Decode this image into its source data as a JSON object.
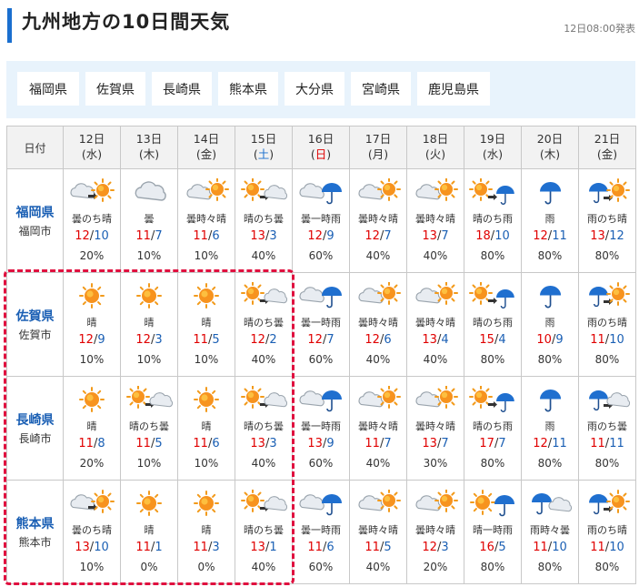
{
  "header": {
    "title": "九州地方の10日間天気",
    "issued": "12日08:00発表"
  },
  "prefectures": [
    "福岡県",
    "佐賀県",
    "長崎県",
    "熊本県",
    "大分県",
    "宮崎県",
    "鹿児島県"
  ],
  "table": {
    "corner_label": "日付",
    "days": [
      {
        "date": "12日",
        "dow": "(水)",
        "dow_type": "normal"
      },
      {
        "date": "13日",
        "dow": "(木)",
        "dow_type": "normal"
      },
      {
        "date": "14日",
        "dow": "(金)",
        "dow_type": "normal"
      },
      {
        "date": "15日",
        "dow": "(土)",
        "dow_type": "sat"
      },
      {
        "date": "16日",
        "dow": "(日)",
        "dow_type": "sun"
      },
      {
        "date": "17日",
        "dow": "(月)",
        "dow_type": "normal"
      },
      {
        "date": "18日",
        "dow": "(火)",
        "dow_type": "normal"
      },
      {
        "date": "19日",
        "dow": "(水)",
        "dow_type": "normal"
      },
      {
        "date": "20日",
        "dow": "(木)",
        "dow_type": "normal"
      },
      {
        "date": "21日",
        "dow": "(金)",
        "dow_type": "normal"
      }
    ],
    "rows": [
      {
        "pref": "福岡県",
        "city": "福岡市",
        "cells": [
          {
            "icon": "cloudy-then-sunny",
            "text": "曇のち晴",
            "hi": "12",
            "lo": "10",
            "pop": "20%"
          },
          {
            "icon": "cloudy",
            "text": "曇",
            "hi": "11",
            "lo": "7",
            "pop": "10%"
          },
          {
            "icon": "cloudy-sometimes-sunny",
            "text": "曇時々晴",
            "hi": "11",
            "lo": "6",
            "pop": "10%"
          },
          {
            "icon": "sunny-then-cloudy",
            "text": "晴のち曇",
            "hi": "13",
            "lo": "3",
            "pop": "40%"
          },
          {
            "icon": "cloudy-sometimes-rain",
            "text": "曇一時雨",
            "hi": "12",
            "lo": "9",
            "pop": "60%"
          },
          {
            "icon": "cloudy-sometimes-sunny",
            "text": "曇時々晴",
            "hi": "12",
            "lo": "7",
            "pop": "40%"
          },
          {
            "icon": "cloudy-sometimes-sunny",
            "text": "曇時々晴",
            "hi": "13",
            "lo": "7",
            "pop": "40%"
          },
          {
            "icon": "sunny-then-rain",
            "text": "晴のち雨",
            "hi": "18",
            "lo": "10",
            "pop": "80%"
          },
          {
            "icon": "rain",
            "text": "雨",
            "hi": "12",
            "lo": "11",
            "pop": "80%"
          },
          {
            "icon": "rain-then-sunny",
            "text": "雨のち晴",
            "hi": "13",
            "lo": "12",
            "pop": "80%"
          }
        ]
      },
      {
        "pref": "佐賀県",
        "city": "佐賀市",
        "cells": [
          {
            "icon": "sunny",
            "text": "晴",
            "hi": "12",
            "lo": "9",
            "pop": "10%"
          },
          {
            "icon": "sunny",
            "text": "晴",
            "hi": "12",
            "lo": "3",
            "pop": "10%"
          },
          {
            "icon": "sunny",
            "text": "晴",
            "hi": "11",
            "lo": "5",
            "pop": "10%"
          },
          {
            "icon": "sunny-then-cloudy",
            "text": "晴のち曇",
            "hi": "12",
            "lo": "2",
            "pop": "40%"
          },
          {
            "icon": "cloudy-sometimes-rain",
            "text": "曇一時雨",
            "hi": "12",
            "lo": "7",
            "pop": "60%"
          },
          {
            "icon": "cloudy-sometimes-sunny",
            "text": "曇時々晴",
            "hi": "12",
            "lo": "6",
            "pop": "40%"
          },
          {
            "icon": "cloudy-sometimes-sunny",
            "text": "曇時々晴",
            "hi": "13",
            "lo": "4",
            "pop": "40%"
          },
          {
            "icon": "sunny-then-rain",
            "text": "晴のち雨",
            "hi": "15",
            "lo": "4",
            "pop": "80%"
          },
          {
            "icon": "rain",
            "text": "雨",
            "hi": "10",
            "lo": "9",
            "pop": "80%"
          },
          {
            "icon": "rain-then-sunny",
            "text": "雨のち晴",
            "hi": "11",
            "lo": "10",
            "pop": "80%"
          }
        ]
      },
      {
        "pref": "長崎県",
        "city": "長崎市",
        "cells": [
          {
            "icon": "sunny",
            "text": "晴",
            "hi": "11",
            "lo": "8",
            "pop": "20%"
          },
          {
            "icon": "sunny-then-cloudy",
            "text": "晴のち曇",
            "hi": "11",
            "lo": "5",
            "pop": "10%"
          },
          {
            "icon": "sunny",
            "text": "晴",
            "hi": "11",
            "lo": "6",
            "pop": "10%"
          },
          {
            "icon": "sunny-then-cloudy",
            "text": "晴のち曇",
            "hi": "13",
            "lo": "3",
            "pop": "40%"
          },
          {
            "icon": "cloudy-sometimes-rain",
            "text": "曇一時雨",
            "hi": "13",
            "lo": "9",
            "pop": "60%"
          },
          {
            "icon": "cloudy-sometimes-sunny",
            "text": "曇時々晴",
            "hi": "11",
            "lo": "7",
            "pop": "40%"
          },
          {
            "icon": "cloudy-sometimes-sunny",
            "text": "曇時々晴",
            "hi": "13",
            "lo": "7",
            "pop": "30%"
          },
          {
            "icon": "sunny-then-rain",
            "text": "晴のち雨",
            "hi": "17",
            "lo": "7",
            "pop": "80%"
          },
          {
            "icon": "rain",
            "text": "雨",
            "hi": "12",
            "lo": "11",
            "pop": "80%"
          },
          {
            "icon": "rain-then-cloudy",
            "text": "雨のち曇",
            "hi": "11",
            "lo": "11",
            "pop": "80%"
          }
        ]
      },
      {
        "pref": "熊本県",
        "city": "熊本市",
        "cells": [
          {
            "icon": "cloudy-then-sunny",
            "text": "曇のち晴",
            "hi": "13",
            "lo": "10",
            "pop": "10%"
          },
          {
            "icon": "sunny",
            "text": "晴",
            "hi": "11",
            "lo": "1",
            "pop": "0%"
          },
          {
            "icon": "sunny",
            "text": "晴",
            "hi": "11",
            "lo": "3",
            "pop": "0%"
          },
          {
            "icon": "sunny-then-cloudy",
            "text": "晴のち曇",
            "hi": "13",
            "lo": "1",
            "pop": "40%"
          },
          {
            "icon": "cloudy-sometimes-rain",
            "text": "曇一時雨",
            "hi": "11",
            "lo": "6",
            "pop": "60%"
          },
          {
            "icon": "cloudy-sometimes-sunny",
            "text": "曇時々晴",
            "hi": "11",
            "lo": "5",
            "pop": "40%"
          },
          {
            "icon": "cloudy-sometimes-sunny",
            "text": "曇時々晴",
            "hi": "12",
            "lo": "3",
            "pop": "20%"
          },
          {
            "icon": "sunny-sometimes-rain",
            "text": "晴一時雨",
            "hi": "16",
            "lo": "5",
            "pop": "80%"
          },
          {
            "icon": "rain-sometimes-cloudy",
            "text": "雨時々曇",
            "hi": "11",
            "lo": "10",
            "pop": "80%"
          },
          {
            "icon": "rain-then-sunny",
            "text": "雨のち晴",
            "hi": "11",
            "lo": "10",
            "pop": "80%"
          }
        ]
      }
    ]
  }
}
